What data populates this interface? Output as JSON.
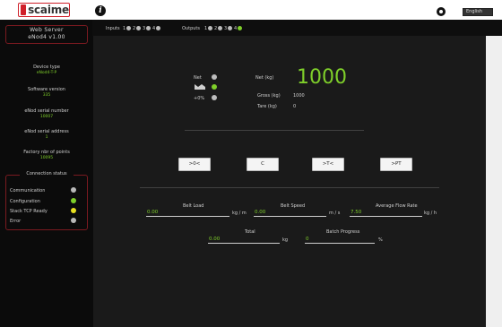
{
  "topbar": {
    "logo_text": "scaime",
    "info_icon": "info-icon",
    "power_icon": "power-icon",
    "language": "English"
  },
  "sidebar": {
    "server_title": "Web Server",
    "server_version": "eNod4 v1.00",
    "device_type_label": "Device type",
    "device_type_value": "eNod4-T-P",
    "software_version_label": "Software version",
    "software_version_value": "335",
    "serial_number_label": "eNod serial number",
    "serial_number_value": "10007",
    "serial_address_label": "eNod serial address",
    "serial_address_value": "1",
    "factory_points_label": "Factory nbr of points",
    "factory_points_value": "10095",
    "connection_title": "Connection status",
    "connection_items": [
      {
        "label": "Communication",
        "color": "#b9b9b9"
      },
      {
        "label": "Configuration",
        "color": "#7fcf2a"
      },
      {
        "label": "Stack TCP Ready",
        "color": "#e8e020"
      },
      {
        "label": "Error",
        "color": "#b9b9b9"
      }
    ]
  },
  "io": {
    "inputs_label": "Inputs",
    "inputs": [
      {
        "num": "1",
        "color": "#bdbdbd"
      },
      {
        "num": "2",
        "color": "#bdbdbd"
      },
      {
        "num": "3",
        "color": "#bdbdbd"
      },
      {
        "num": "4",
        "color": "#bdbdbd"
      }
    ],
    "outputs_label": "Outputs",
    "outputs": [
      {
        "num": "1",
        "color": "#bdbdbd"
      },
      {
        "num": "2",
        "color": "#bdbdbd"
      },
      {
        "num": "3",
        "color": "#bdbdbd"
      },
      {
        "num": "4",
        "color": "#7fcf2a"
      }
    ]
  },
  "weight": {
    "net_label": "Net (kg)",
    "net_value": "1000",
    "gross_label": "Gross (kg)",
    "gross_value": "1000",
    "tare_label": "Tare (kg)",
    "tare_value": "0",
    "status_rows": [
      {
        "label": "Net",
        "color": "#bdbdbd"
      },
      {
        "label": "",
        "color": "#7fcf2a"
      },
      {
        "label": "+0%",
        "color": "#bdbdbd"
      }
    ]
  },
  "buttons": [
    ">0<",
    "C",
    ">T<",
    ">PT"
  ],
  "fields": {
    "belt_load_title": "Belt Load",
    "belt_load_value": "0.00",
    "belt_load_unit": "kg / m",
    "belt_speed_title": "Belt Speed",
    "belt_speed_value": "0.00",
    "belt_speed_unit": "m / s",
    "flow_rate_title": "Average Flow Rate",
    "flow_rate_value": "7.50",
    "flow_rate_unit": "kg / h",
    "total_title": "Total",
    "total_value": "0.00",
    "total_unit": "kg",
    "batch_title": "Batch Progress",
    "batch_value": "0",
    "batch_unit": "%"
  },
  "colors": {
    "accent_green": "#7fcf2a",
    "status_yellow": "#e8e020",
    "status_grey": "#b9b9b9",
    "border_red": "#7a1a20"
  }
}
